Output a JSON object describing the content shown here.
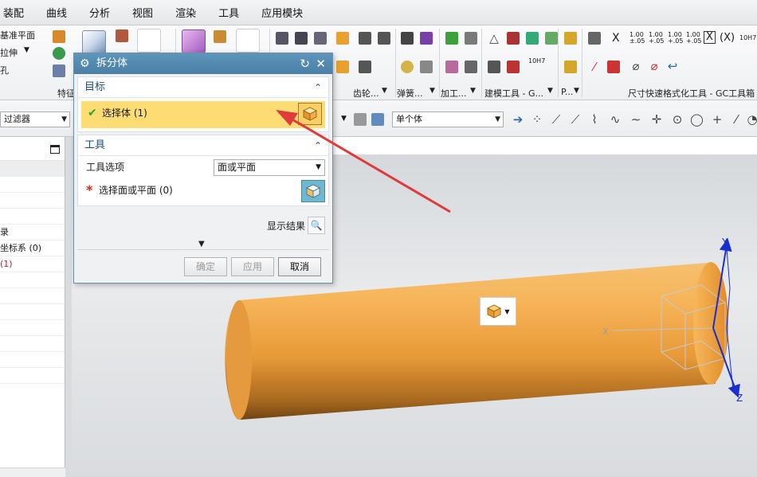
{
  "menu": [
    "装配",
    "曲线",
    "分析",
    "视图",
    "渲染",
    "工具",
    "应用模块"
  ],
  "ribbon": {
    "datum_plane": "基准平面",
    "extrude": "拉伸",
    "hole": "孔",
    "group_feature": "特征",
    "group_contour": "齿轮...",
    "group_spring": "弹簧...",
    "group_machining": "加工...",
    "group_modeling_tools": "建模工具 - G...",
    "group_p": "P...",
    "group_dimension": "尺寸快速格式化工具 - GC工具箱",
    "tol_1": "1.00\n±.05",
    "tol_2": "1.00\n+.05",
    "tol_3": "1.00\n+.05",
    "tol_4": "1.00\n+.05",
    "fit_label": "10H7",
    "fit_label_2": "10H7",
    "x_label": "X",
    "x_box": "X",
    "x_paren": "(X)"
  },
  "toolbar2": {
    "filter_label": "过滤器",
    "body_scope": "单个体"
  },
  "navigator": {
    "rows": [
      "",
      "",
      "",
      "",
      "录",
      "坐标系 (0)",
      "(1)",
      "",
      "",
      "",
      "",
      "",
      "",
      ""
    ]
  },
  "dialog": {
    "title": "拆分体",
    "target_section": "目标",
    "select_body": "选择体 (1)",
    "tool_section": "工具",
    "tool_option_label": "工具选项",
    "tool_option_value": "面或平面",
    "select_face": "选择面或平面 (0)",
    "show_result": "显示结果",
    "ok": "确定",
    "apply": "应用",
    "cancel": "取消"
  },
  "viewport": {
    "axis_x": "X",
    "axis_y": "Y",
    "axis_z": "Z"
  },
  "colors": {
    "cylinder": "#f0a848",
    "selection_highlight": "#fddc73",
    "dialog_title": "#4f86ad",
    "arrow": "#e03b3b",
    "axis_blue": "#1a2ed0"
  }
}
